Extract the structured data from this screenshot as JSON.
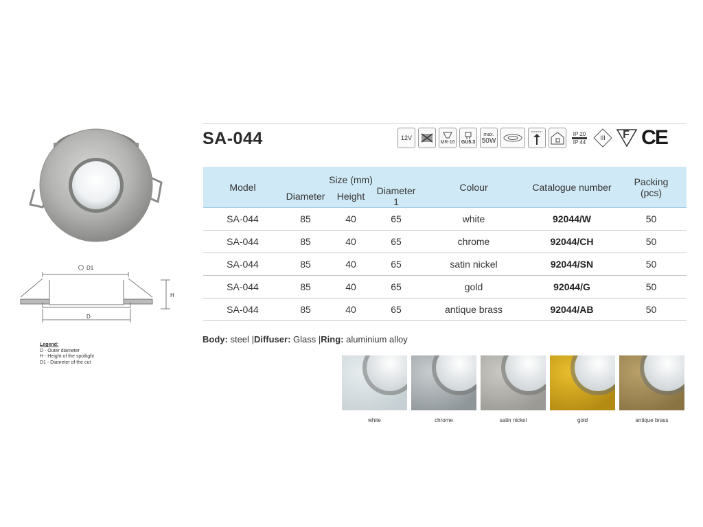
{
  "product": {
    "title": "SA-044",
    "icons": [
      {
        "name": "12v-icon",
        "label": "12V"
      },
      {
        "name": "no-insulation-cover-icon",
        "label": ""
      },
      {
        "name": "mr16-lamp-icon",
        "label": "MR-16"
      },
      {
        "name": "gu53-socket-icon",
        "label": "GU5.3"
      },
      {
        "name": "max-wattage-icon",
        "label_top": "max.",
        "label": "50W"
      },
      {
        "name": "recessed-fitting-icon",
        "label": ""
      },
      {
        "name": "ceiling-mount-icon",
        "label": ""
      },
      {
        "name": "indoor-use-icon",
        "label": ""
      },
      {
        "name": "ip-rating-icon",
        "label_top": "IP 20",
        "label": "IP 44"
      },
      {
        "name": "class-iii-icon",
        "label": "III"
      },
      {
        "name": "f-mark-icon",
        "label": "F"
      },
      {
        "name": "ce-mark-icon",
        "label": "CE"
      }
    ]
  },
  "table": {
    "headers": {
      "model": "Model",
      "size": "Size (mm)",
      "diameter": "Diameter",
      "height": "Height",
      "diameter1": "Diameter 1",
      "colour": "Colour",
      "catalogue": "Catalogue number",
      "packing": "Packing",
      "packing_unit": "(pcs)"
    },
    "rows": [
      {
        "model": "SA-044",
        "diameter": "85",
        "height": "40",
        "diameter1": "65",
        "colour": "white",
        "catalogue": "92044/W",
        "packing": "50"
      },
      {
        "model": "SA-044",
        "diameter": "85",
        "height": "40",
        "diameter1": "65",
        "colour": "chrome",
        "catalogue": "92044/CH",
        "packing": "50"
      },
      {
        "model": "SA-044",
        "diameter": "85",
        "height": "40",
        "diameter1": "65",
        "colour": "satin nickel",
        "catalogue": "92044/SN",
        "packing": "50"
      },
      {
        "model": "SA-044",
        "diameter": "85",
        "height": "40",
        "diameter1": "65",
        "colour": "gold",
        "catalogue": "92044/G",
        "packing": "50"
      },
      {
        "model": "SA-044",
        "diameter": "85",
        "height": "40",
        "diameter1": "65",
        "colour": "antique brass",
        "catalogue": "92044/AB",
        "packing": "50"
      }
    ]
  },
  "materials": {
    "body_label": "Body:",
    "body_value": "steel",
    "sep1": "|",
    "diffuser_label": "Diffuser:",
    "diffuser_value": "Glass",
    "sep2": "|",
    "ring_label": "Ring:",
    "ring_value": "aluminium alloy"
  },
  "drawing": {
    "d1_label": "D1",
    "h_label": "H",
    "d_label": "D"
  },
  "legend": {
    "title": "Legend:",
    "lines": [
      "D - Outer diameter",
      "H - Height of the spotlight",
      "D1 - Diameter of the cut"
    ]
  },
  "finishes": [
    {
      "label": "white",
      "ring_color": "#e6ecee",
      "ring_dark": "#c7d0d4"
    },
    {
      "label": "chrome",
      "ring_color": "#c8cdcf",
      "ring_dark": "#8f969a"
    },
    {
      "label": "satin nickel",
      "ring_color": "#c9c8c3",
      "ring_dark": "#9b9a95"
    },
    {
      "label": "gold",
      "ring_color": "#e8bd2c",
      "ring_dark": "#b38a12"
    },
    {
      "label": "antique brass",
      "ring_color": "#b9a06a",
      "ring_dark": "#8a7444"
    }
  ],
  "colors": {
    "header_bg": "#d0e9f6",
    "row_rule": "#c9c9c9"
  }
}
